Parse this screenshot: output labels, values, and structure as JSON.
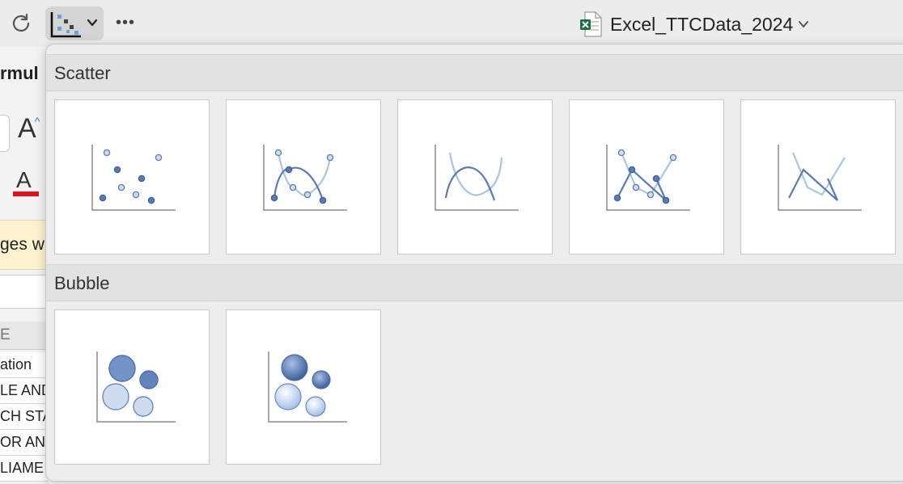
{
  "toolbar": {
    "refresh_icon": "refresh-icon",
    "chart_type_icon": "scatter-chart-icon",
    "more_label": "•••",
    "workbook_title": "Excel_TTCData_2024"
  },
  "background_sheet": {
    "ribbon_fragment": "rmul",
    "font_size_label": "A",
    "font_color_label": "A",
    "message_fragment": "ges w",
    "column_header": "E",
    "rows": [
      "ation",
      "LE AND",
      "CH STA",
      "OR AN",
      "LIAME"
    ]
  },
  "sections": [
    {
      "title": "Scatter",
      "items": [
        "Scatter",
        "Scatter with Smooth Lines and Markers",
        "Scatter with Smooth Lines",
        "Scatter with Straight Lines and Markers",
        "Scatter with Straight Lines"
      ]
    },
    {
      "title": "Bubble",
      "items": [
        "Bubble",
        "3-D Bubble"
      ]
    }
  ],
  "colors": {
    "accent_dark": "#5a7bb3",
    "accent_light": "#a9c5e6",
    "axis": "#8a8a8a",
    "marker_fill": "#cfdcf0"
  }
}
